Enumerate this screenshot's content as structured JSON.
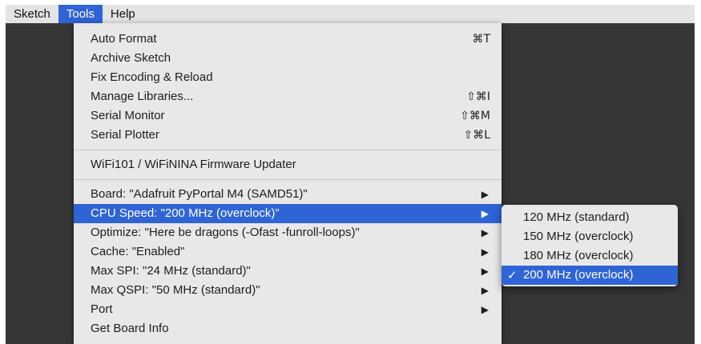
{
  "menubar": {
    "items": [
      "Sketch",
      "Tools",
      "Help"
    ]
  },
  "tools_menu": {
    "group1": [
      {
        "label": "Auto Format",
        "shortcut": "⌘T"
      },
      {
        "label": "Archive Sketch",
        "shortcut": ""
      },
      {
        "label": "Fix Encoding & Reload",
        "shortcut": ""
      },
      {
        "label": "Manage Libraries...",
        "shortcut": "⇧⌘I"
      },
      {
        "label": "Serial Monitor",
        "shortcut": "⇧⌘M"
      },
      {
        "label": "Serial Plotter",
        "shortcut": "⇧⌘L"
      }
    ],
    "group2": [
      {
        "label": "WiFi101 / WiFiNINA Firmware Updater"
      }
    ],
    "group3": [
      {
        "label": "Board: \"Adafruit PyPortal M4 (SAMD51)\"",
        "arrow": "▶"
      },
      {
        "label": "CPU Speed: \"200 MHz (overclock)\"",
        "arrow": "▶"
      },
      {
        "label": "Optimize: \"Here be dragons (-Ofast -funroll-loops)\"",
        "arrow": "▶"
      },
      {
        "label": "Cache: \"Enabled\"",
        "arrow": "▶"
      },
      {
        "label": "Max SPI: \"24 MHz (standard)\"",
        "arrow": "▶"
      },
      {
        "label": "Max QSPI: \"50 MHz (standard)\"",
        "arrow": "▶"
      },
      {
        "label": "Port",
        "arrow": "▶"
      },
      {
        "label": "Get Board Info",
        "arrow": ""
      }
    ]
  },
  "cpu_submenu": {
    "check_mark": "✓",
    "items": [
      "120 MHz (standard)",
      "150 MHz (overclock)",
      "180 MHz (overclock)",
      "200 MHz (overclock)"
    ]
  },
  "colors": {
    "highlight": "#2f64d6",
    "menu_bg": "#e8e8e8",
    "app_bg": "#363636"
  }
}
